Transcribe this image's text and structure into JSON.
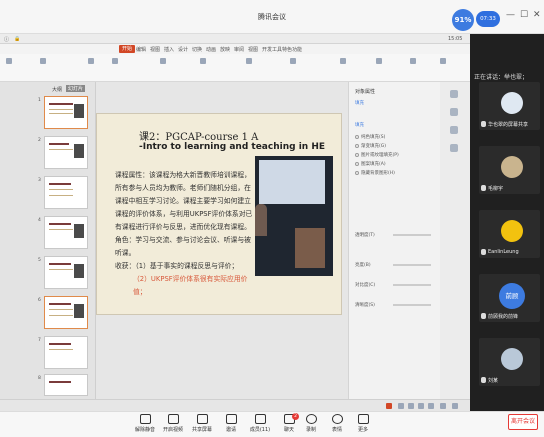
{
  "window": {
    "title": "腾讯会议",
    "perf_score": "91%",
    "timer": "07:33"
  },
  "presenter_os": {
    "clock": "15:05",
    "menu": [
      "文件",
      "编辑",
      "视图",
      "插入",
      "设计",
      "切换",
      "动画",
      "放映",
      "审阅",
      "视图",
      "开发工具",
      "特色功能"
    ],
    "active_menu": "开始",
    "thumbs_tabs": [
      "大纲",
      "幻灯片"
    ],
    "slide_numbers": [
      "1",
      "2",
      "3",
      "4",
      "5",
      "6",
      "7",
      "8"
    ]
  },
  "slide": {
    "title1": "课2：PGCAP-course 1 A",
    "title2": "-Intro to learning and teaching in HE",
    "body": [
      {
        "text": "课程属性：该课程为格大新晋教师培训课程，所有参与人员均为教师。老师们随机分组，在课程中相互学习讨论。课程主要学习如何建立课程的评价体系，与利用UKPSF评价体系对已有课程进行评价与反思，进而优化现有课程。"
      },
      {
        "text": "角色：学习与交流、参与讨论会议、听课与被听课。"
      },
      {
        "text": "收获：（1）基于事实的课程反思与评价；"
      },
      {
        "text": "（2）UKPSF评价体系很有实际应用价值；"
      }
    ]
  },
  "property_pane": {
    "title": "对象属性",
    "tab": "填充",
    "section": "填充",
    "options": [
      "纯色填充(S)",
      "渐变填充(G)",
      "图片或纹理填充(P)",
      "图案填充(A)",
      "隐藏背景图形(H)"
    ],
    "sliders": [
      "透明度(T)",
      "亮度(B)",
      "对比度(C)",
      "清晰度(S)"
    ]
  },
  "participants": {
    "speaking_label": "正在讲话：举也翠；",
    "tiles": [
      {
        "name": "华也翠的屏幕共享",
        "avatar": "photo"
      },
      {
        "name": "毛柳宇",
        "avatar": "photo"
      },
      {
        "name": "EanlinLeung",
        "avatar": "photo"
      },
      {
        "name": "前顾我的前锋",
        "avatar": "前顾"
      },
      {
        "name": "刘某",
        "avatar": "photo"
      }
    ]
  },
  "toolbar": {
    "items": [
      {
        "label": "解除静音",
        "icon": "mic-icon"
      },
      {
        "label": "开启视频",
        "icon": "camera-icon"
      },
      {
        "label": "共享屏幕",
        "icon": "screen-share-icon"
      },
      {
        "label": "邀请",
        "icon": "invite-icon"
      },
      {
        "label": "成员(11)",
        "icon": "members-icon"
      },
      {
        "label": "聊天",
        "icon": "chat-icon",
        "badge": "2"
      },
      {
        "label": "录制",
        "icon": "record-icon"
      },
      {
        "label": "表情",
        "icon": "emoji-icon"
      },
      {
        "label": "更多",
        "icon": "more-icon"
      }
    ],
    "leave_label": "离开会议"
  },
  "colors": {
    "accent_blue": "#3d7be0",
    "wps_red": "#d24726",
    "leave_red": "#e53935",
    "highlight_red": "#d8593b"
  }
}
